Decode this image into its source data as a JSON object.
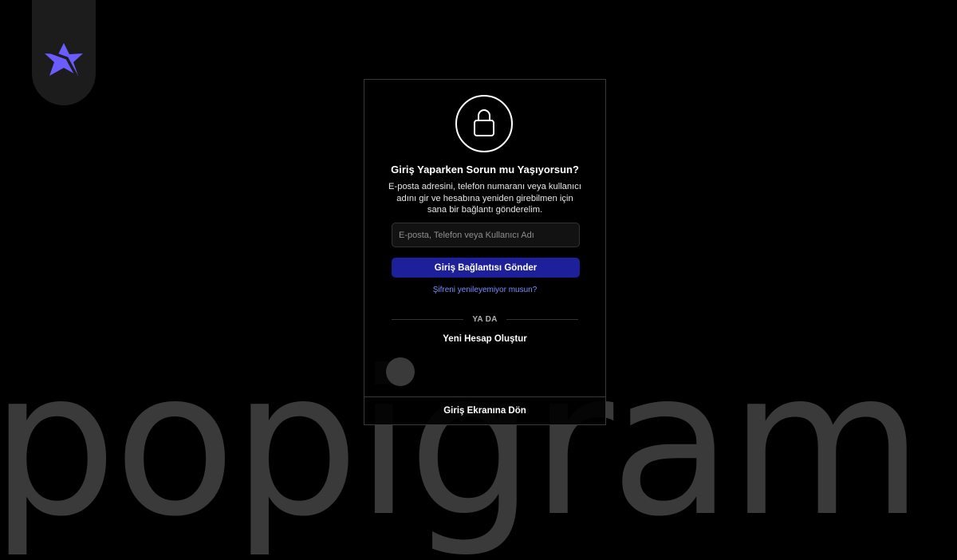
{
  "background": {
    "watermark_text": "popigram"
  },
  "brand": {
    "logo_icon": "star-logo-icon",
    "logo_color": "#6b5cff"
  },
  "card": {
    "lock_icon": "lock-icon",
    "title": "Giriş Yaparken Sorun mu Yaşıyorsun?",
    "description": "E-posta adresini, telefon numaranı veya kullanıcı adını gir ve hesabına yeniden girebilmen için sana bir bağlantı gönderelim.",
    "input": {
      "placeholder": "E-posta, Telefon veya Kullanıcı Adı",
      "value": ""
    },
    "send_button_label": "Giriş Bağlantısı Gönder",
    "reset_link": "Şifreni yenileyemiyor musun?",
    "divider_label": "YA DA",
    "create_account_label": "Yeni Hesap Oluştur",
    "back_to_login_label": "Giriş Ekranına Dön"
  },
  "colors": {
    "accent": "#1e1f9a",
    "link": "#7c8cff",
    "background": "#000000"
  }
}
